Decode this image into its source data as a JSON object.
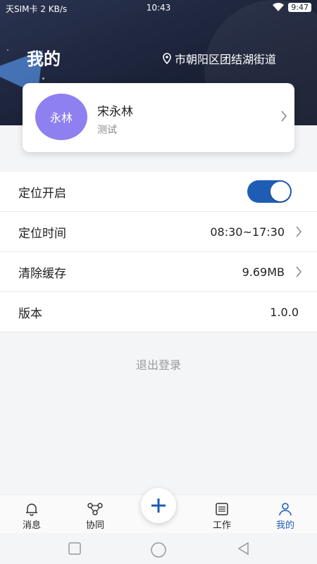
{
  "status_bar": {
    "left": "天SIM卡 2 KB/s",
    "time": "10:43",
    "battery": "9:47"
  },
  "header": {
    "title": "我的",
    "location": "市朝阳区团结湖街道"
  },
  "profile": {
    "avatar_text": "永林",
    "name": "宋永林",
    "subtitle": "测试"
  },
  "settings": {
    "location_enabled_label": "定位开启",
    "location_enabled": true,
    "location_time_label": "定位时间",
    "location_time_value": "08:30~17:30",
    "clear_cache_label": "清除缓存",
    "cache_size": "9.69MB",
    "version_label": "版本",
    "version_value": "1.0.0"
  },
  "logout_label": "退出登录",
  "tabs": {
    "messages": "消息",
    "collab": "协同",
    "work": "工作",
    "mine": "我的"
  },
  "colors": {
    "accent": "#1f5db5",
    "avatar": "#8e80f0",
    "header_bg": "#1b2238"
  },
  "icons": [
    "location-pin-icon",
    "chevron-right-icon",
    "bell-icon",
    "collab-icon",
    "plus-icon",
    "list-icon",
    "user-icon",
    "square-icon",
    "circle-icon",
    "back-triangle-icon"
  ]
}
